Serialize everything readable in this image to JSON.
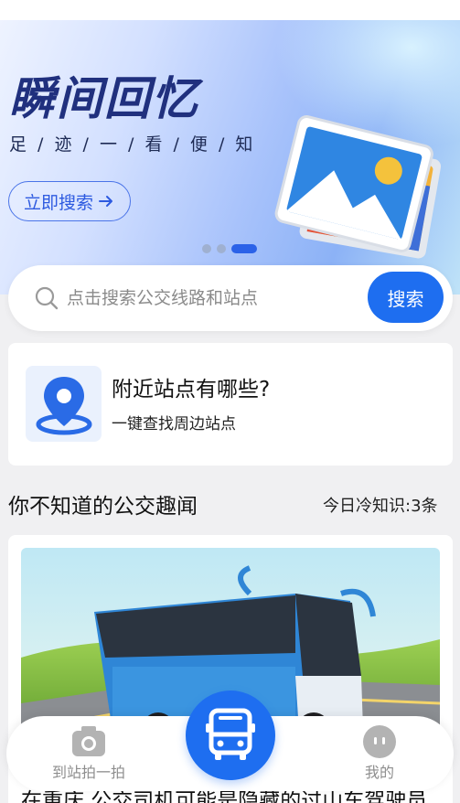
{
  "banner": {
    "title": "瞬间回忆",
    "subtitle": "足 / 迹 / 一 / 看 / 便 / 知",
    "button_label": "立即搜索",
    "dots": 3,
    "active_dot": 3
  },
  "search": {
    "placeholder": "点击搜索公交线路和站点",
    "button_label": "搜索"
  },
  "nearby": {
    "title": "附近站点有哪些?",
    "subtitle": "一键查找周边站点"
  },
  "news_section": {
    "title": "你不知道的公交趣闻",
    "meta": "今日冷知识:3条"
  },
  "news_card": {
    "headline": "在重庆,公交司机可能是隐藏的过山车驾驶员"
  },
  "tabbar": {
    "photo_label": "到站拍一拍",
    "mine_label": "我的"
  },
  "colors": {
    "accent": "#1e6ef0",
    "banner_title": "#20307e",
    "page_bg": "#f0f0f2"
  },
  "icons": {
    "search": "search-icon",
    "location": "location-pin-icon",
    "camera": "camera-icon",
    "bus": "bus-icon",
    "profile": "profile-icon",
    "arrow": "arrow-right-icon"
  }
}
